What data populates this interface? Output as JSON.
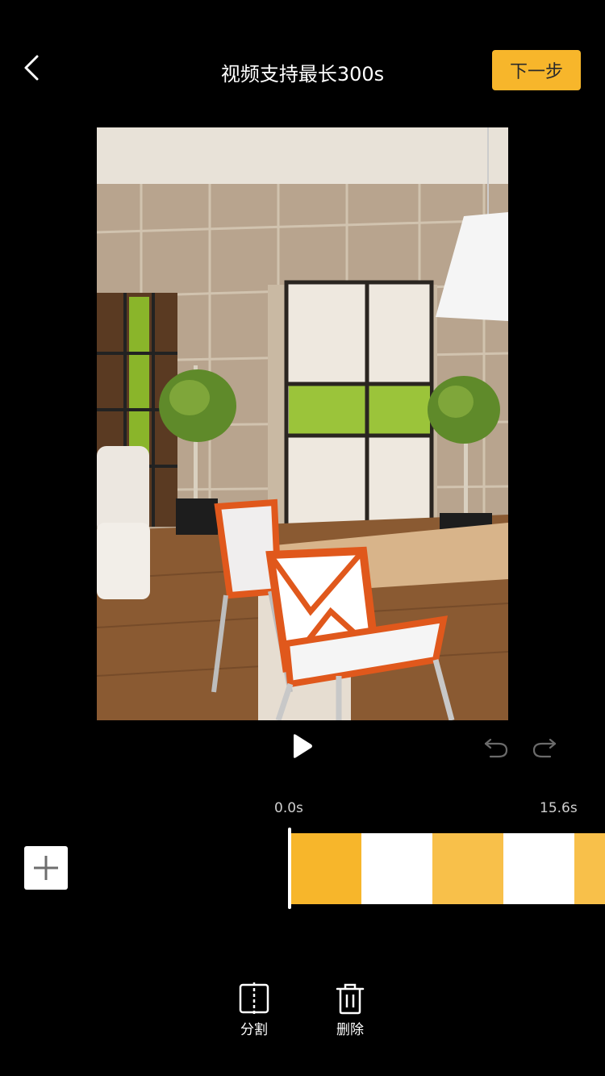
{
  "header": {
    "title": "视频支持最长300s",
    "next_label": "下一步"
  },
  "timeline": {
    "start_time": "0.0s",
    "end_time": "15.6s",
    "segments": [
      "#f7b62b",
      "#ffffff",
      "#f8c04a",
      "#ffffff",
      "#f8c04a"
    ]
  },
  "toolbar": {
    "split_label": "分割",
    "delete_label": "删除"
  },
  "colors": {
    "accent": "#f7b62b",
    "background": "#000000"
  },
  "icons": {
    "back": "back-icon",
    "play": "play-icon",
    "undo": "undo-icon",
    "redo": "redo-icon",
    "add": "plus-icon",
    "split": "split-icon",
    "delete": "trash-icon"
  }
}
